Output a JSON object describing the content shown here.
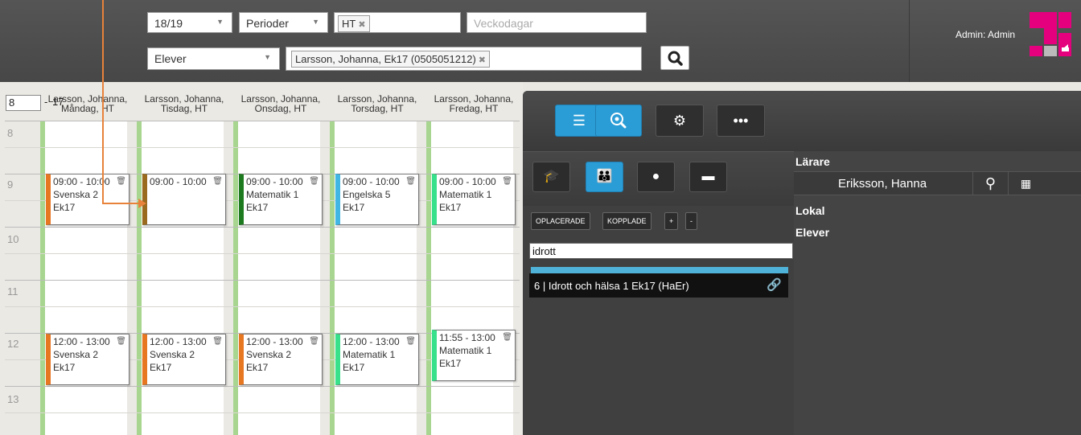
{
  "topbar": {
    "year": "18/19",
    "period_placeholder": "Perioder",
    "period_tag": "HT",
    "weekdays_placeholder": "Veckodagar",
    "view_type": "Elever",
    "student_tag": "Larsson, Johanna, Ek17 (0505051212)",
    "admin_label": "Admin: Admin"
  },
  "schedule": {
    "range_start": "8",
    "range_sep": "-",
    "range_end": "17",
    "days": [
      {
        "header": "Larsson, Johanna, Måndag, HT"
      },
      {
        "header": "Larsson, Johanna, Tisdag, HT"
      },
      {
        "header": "Larsson, Johanna, Onsdag, HT"
      },
      {
        "header": "Larsson, Johanna, Torsdag, HT"
      },
      {
        "header": "Larsson, Johanna, Fredag, HT"
      }
    ],
    "hours": [
      "8",
      "9",
      "10",
      "11",
      "12",
      "13"
    ],
    "lessons": [
      {
        "time": "09:00 - 10:00",
        "subject": "Svenska 2",
        "group": "Ek17",
        "color": "#e87722"
      },
      {
        "time": "09:00 - 10:00",
        "subject": "",
        "group": "",
        "color": "#9a6a1e"
      },
      {
        "time": "09:00 - 10:00",
        "subject": "Matematik 1",
        "group": "Ek17",
        "color": "#1e7a1e"
      },
      {
        "time": "09:00 - 10:00",
        "subject": "Engelska 5",
        "group": "Ek17",
        "color": "#3fb6e3"
      },
      {
        "time": "09:00 - 10:00",
        "subject": "Matematik 1",
        "group": "Ek17",
        "color": "#37e08a"
      },
      {
        "time": "12:00 - 13:00",
        "subject": "Svenska 2",
        "group": "Ek17",
        "color": "#e87722"
      },
      {
        "time": "12:00 - 13:00",
        "subject": "Svenska 2",
        "group": "Ek17",
        "color": "#e87722"
      },
      {
        "time": "12:00 - 13:00",
        "subject": "Svenska 2",
        "group": "Ek17",
        "color": "#e87722"
      },
      {
        "time": "12:00 - 13:00",
        "subject": "Matematik 1",
        "group": "Ek17",
        "color": "#37e08a"
      },
      {
        "time": "11:55 - 13:00",
        "subject": "Matematik 1",
        "group": "Ek17",
        "color": "#37e08a"
      }
    ]
  },
  "panel": {
    "tab_icons": [
      "list-icon",
      "search-zoom-icon",
      "gear-icon",
      "more-icon"
    ],
    "sub_icons": [
      "teacher-icon",
      "group-icon",
      "person-icon",
      "folder-icon"
    ],
    "mini_buttons": [
      "OPLACERADE",
      "KOPPLADE",
      "+",
      "-"
    ],
    "filter_value": "idrott",
    "course_item": "6 | Idrott och hälsa 1 Ek17 (HaEr)",
    "labels": {
      "teacher": "Lärare",
      "room": "Lokal",
      "students": "Elever"
    },
    "teacher_name": "Eriksson, Hanna"
  },
  "colors": {
    "accent": "#2b9dd6",
    "logo": "#e5007e"
  }
}
